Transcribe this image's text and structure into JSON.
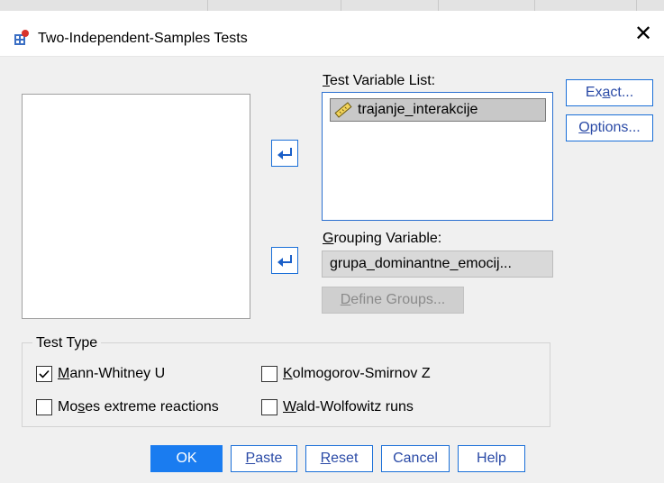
{
  "window": {
    "title": "Two-Independent-Samples Tests",
    "close_glyph": "✕"
  },
  "labels": {
    "test_variable_list": "Test Variable List:",
    "test_variable_list_key": "T",
    "test_variable_list_rest": "est Variable List:",
    "grouping_variable_key": "G",
    "grouping_variable_rest": "rouping Variable:"
  },
  "test_variables": [
    {
      "name": "trajanje_interakcije",
      "icon": "ruler-icon"
    }
  ],
  "grouping_variable": {
    "value": "grupa_dominantne_emocij..."
  },
  "buttons": {
    "exact_pre": "Ex",
    "exact_key": "a",
    "exact_post": "ct...",
    "options_key": "O",
    "options_post": "ptions...",
    "define_key": "D",
    "define_post": "efine Groups...",
    "ok": "OK",
    "paste_key": "P",
    "paste_post": "aste",
    "reset_key": "R",
    "reset_post": "eset",
    "cancel": "Cancel",
    "help": "Help"
  },
  "test_type": {
    "legend": "Test Type",
    "options": [
      {
        "pre": "",
        "key": "M",
        "post": "ann-Whitney U",
        "checked": true
      },
      {
        "pre": "",
        "key": "K",
        "post": "olmogorov-Smirnov Z",
        "checked": false
      },
      {
        "pre": "Mo",
        "key": "s",
        "post": "es extreme reactions",
        "checked": false
      },
      {
        "pre": "",
        "key": "W",
        "post": "ald-Wolfowitz runs",
        "checked": false
      }
    ]
  },
  "colors": {
    "accent": "#1a7cf0",
    "border_blue": "#1a6fd8",
    "selection": "#c8c8c8"
  }
}
